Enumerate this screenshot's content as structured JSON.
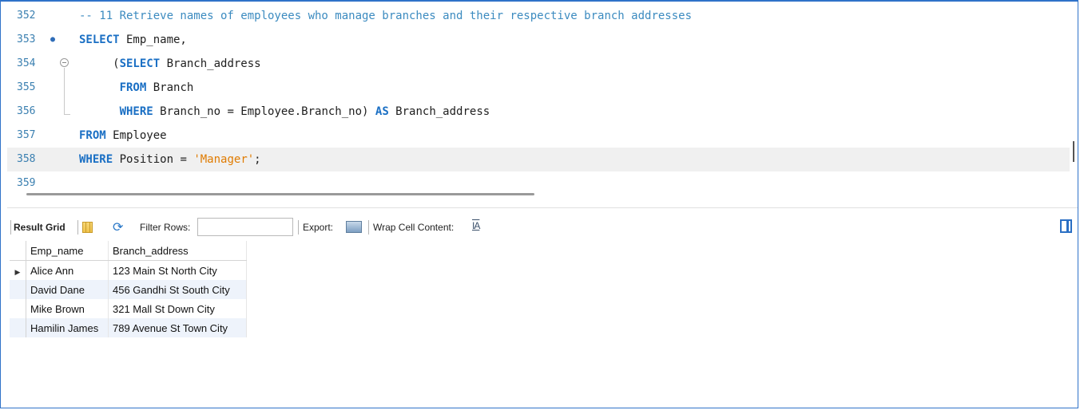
{
  "editor": {
    "lines": [
      {
        "number": "352",
        "marker": "",
        "segments": [
          {
            "t": "-- 11 Retrieve names of employees who manage branches and their respective branch addresses",
            "c": "cm"
          }
        ]
      },
      {
        "number": "353",
        "marker": "●",
        "segments": [
          {
            "t": "SELECT",
            "c": "kw"
          },
          {
            "t": " Emp_name,",
            "c": ""
          }
        ]
      },
      {
        "number": "354",
        "marker": "",
        "segments": [
          {
            "t": "     (",
            "c": ""
          },
          {
            "t": "SELECT",
            "c": "kw"
          },
          {
            "t": " Branch_address",
            "c": ""
          }
        ]
      },
      {
        "number": "355",
        "marker": "",
        "segments": [
          {
            "t": "      ",
            "c": ""
          },
          {
            "t": "FROM",
            "c": "kw"
          },
          {
            "t": " Branch",
            "c": ""
          }
        ]
      },
      {
        "number": "356",
        "marker": "",
        "segments": [
          {
            "t": "      ",
            "c": ""
          },
          {
            "t": "WHERE",
            "c": "kw"
          },
          {
            "t": " Branch_no = Employee.Branch_no) ",
            "c": ""
          },
          {
            "t": "AS",
            "c": "kw"
          },
          {
            "t": " Branch_address",
            "c": ""
          }
        ]
      },
      {
        "number": "357",
        "marker": "",
        "segments": [
          {
            "t": "FROM",
            "c": "kw"
          },
          {
            "t": " Employee",
            "c": ""
          }
        ]
      },
      {
        "number": "358",
        "marker": "",
        "segments": [
          {
            "t": "WHERE",
            "c": "kw"
          },
          {
            "t": " Position = ",
            "c": ""
          },
          {
            "t": "'Manager'",
            "c": "str"
          },
          {
            "t": ";",
            "c": ""
          }
        ]
      },
      {
        "number": "359",
        "marker": "",
        "segments": []
      }
    ],
    "current_line": "358"
  },
  "toolbar": {
    "result_grid_label": "Result Grid",
    "filter_label": "Filter Rows:",
    "filter_value": "",
    "export_label": "Export:",
    "wrap_label": "Wrap Cell Content:",
    "wrap_icon_text": "IA"
  },
  "grid": {
    "columns": [
      "Emp_name",
      "Branch_address"
    ],
    "rows": [
      [
        "Alice Ann",
        "123 Main St North City"
      ],
      [
        "David Dane",
        "456 Gandhi St South City"
      ],
      [
        "Mike Brown",
        "321 Mall St Down City"
      ],
      [
        "Hamilin James",
        "789 Avenue St Town City"
      ]
    ],
    "row_pointer": "▶"
  },
  "colors": {
    "keyword": "#1a6fc4",
    "comment": "#3c8bc0",
    "string": "#e07b00",
    "line_number": "#3a7fb0",
    "frame_border": "#2f72c9"
  }
}
